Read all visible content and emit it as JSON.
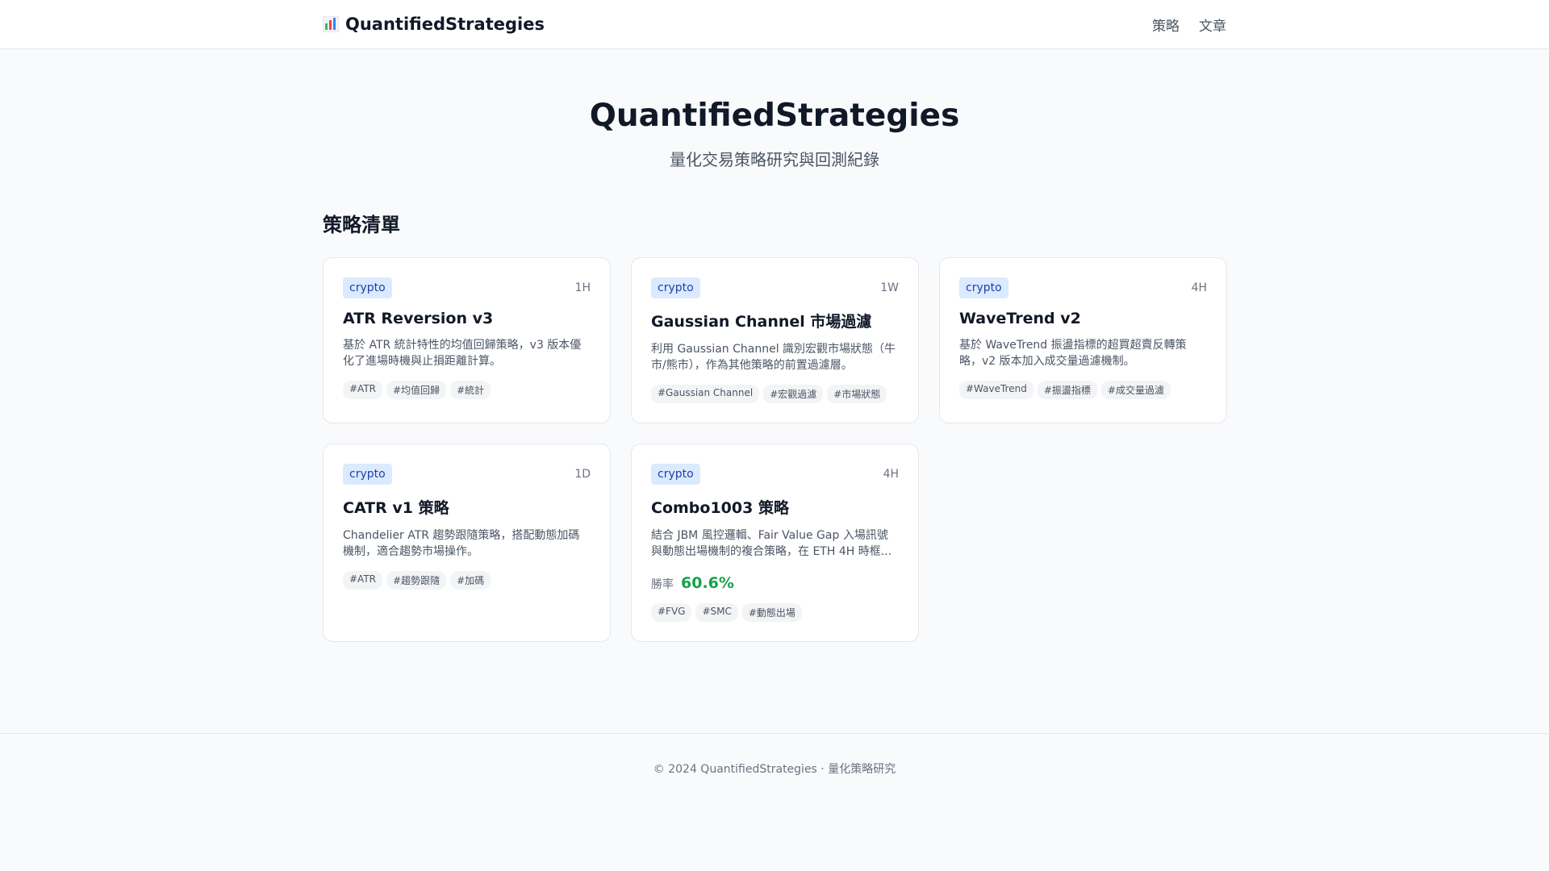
{
  "header": {
    "brand": "QuantifiedStrategies",
    "logo_icon": "bar-chart-icon",
    "nav": [
      "策略",
      "文章"
    ]
  },
  "hero": {
    "title": "QuantifiedStrategies",
    "subtitle": "量化交易策略研究與回測紀錄"
  },
  "section_title": "策略清單",
  "colors": {
    "badge_bg": "#dbeafe",
    "badge_text": "#1e40af",
    "win_rate": "#16a34a"
  },
  "strategies": [
    {
      "category": "crypto",
      "timeframe": "1H",
      "title": "ATR Reversion v3",
      "description": "基於 ATR 統計特性的均值回歸策略，v3 版本優化了進場時機與止損距離計算。",
      "tags": [
        "#ATR",
        "#均值回歸",
        "#統計"
      ]
    },
    {
      "category": "crypto",
      "timeframe": "1W",
      "title": "Gaussian Channel 市場過濾",
      "description": "利用 Gaussian Channel 識別宏觀市場狀態（牛市/熊市），作為其他策略的前置過濾層。",
      "tags": [
        "#Gaussian Channel",
        "#宏觀過濾",
        "#市場狀態"
      ]
    },
    {
      "category": "crypto",
      "timeframe": "4H",
      "title": "WaveTrend v2",
      "description": "基於 WaveTrend 振盪指標的超買超賣反轉策略，v2 版本加入成交量過濾機制。",
      "tags": [
        "#WaveTrend",
        "#振盪指標",
        "#成交量過濾"
      ]
    },
    {
      "category": "crypto",
      "timeframe": "1D",
      "title": "CATR v1 策略",
      "description": "Chandelier ATR 趨勢跟隨策略，搭配動態加碼機制，適合趨勢市場操作。",
      "tags": [
        "#ATR",
        "#趨勢跟隨",
        "#加碼"
      ]
    },
    {
      "category": "crypto",
      "timeframe": "4H",
      "title": "Combo1003 策略",
      "description": "結合 JBM 風控邏輯、Fair Value Gap 入場訊號與動態出場機制的複合策略，在 ETH 4H 時框...",
      "win_rate_label": "勝率",
      "win_rate": "60.6%",
      "tags": [
        "#FVG",
        "#SMC",
        "#動態出場"
      ]
    }
  ],
  "footer": {
    "text": "© 2024 QuantifiedStrategies · 量化策略研究"
  }
}
